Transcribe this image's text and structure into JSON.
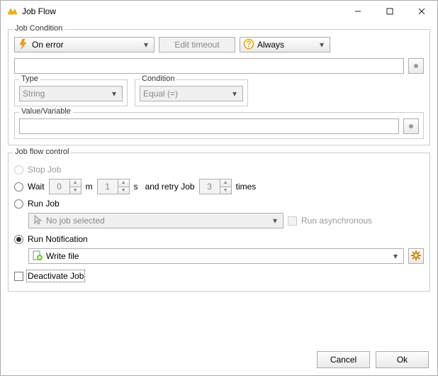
{
  "window": {
    "title": "Job Flow"
  },
  "jobCondition": {
    "legend": "Job Condition",
    "onError": "On error",
    "editTimeout": "Edit timeout",
    "always": "Always",
    "type": {
      "legend": "Type",
      "value": "String"
    },
    "condition": {
      "legend": "Condition",
      "value": "Equal (=)"
    },
    "valueVar": {
      "legend": "Value/Variable",
      "value": ""
    }
  },
  "flow": {
    "legend": "Job flow control",
    "stopJob": "Stop Job",
    "wait": {
      "label": "Wait",
      "min": "0",
      "mUnit": "m",
      "sec": "1",
      "sUnit": "s",
      "retryLabel": "and retry Job",
      "retry": "3",
      "times": "times"
    },
    "runJob": {
      "label": "Run Job",
      "value": "No job selected",
      "async": "Run asynchronous"
    },
    "runNotif": {
      "label": "Run Notification",
      "value": "Write file"
    },
    "deactivate": "Deactivate Job"
  },
  "buttons": {
    "cancel": "Cancel",
    "ok": "Ok"
  }
}
